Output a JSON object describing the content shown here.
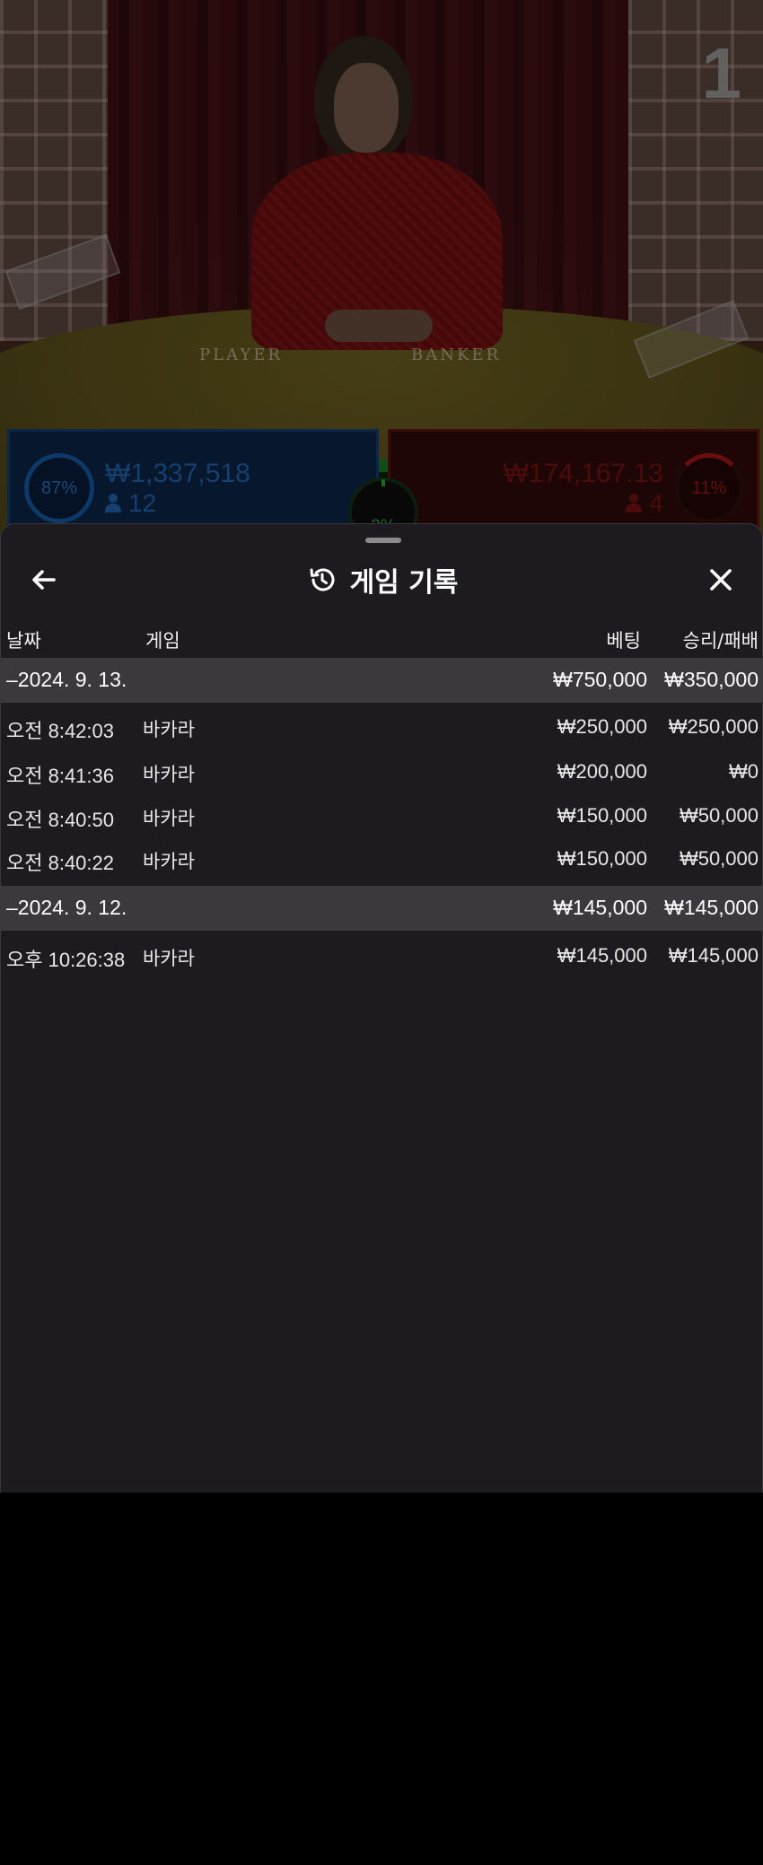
{
  "video": {
    "table_number": "1",
    "player_label": "PLAYER",
    "banker_label": "BANKER"
  },
  "bets": {
    "player": {
      "percent": "87%",
      "amount": "₩1,337,518",
      "players": "12",
      "color": "#2674c8"
    },
    "banker": {
      "percent": "11%",
      "amount": "₩174,167.13",
      "players": "4",
      "color": "#8a1414"
    },
    "tie": {
      "percent": "2%",
      "color": "#2fbf3c"
    }
  },
  "sheet": {
    "title": "게임 기록",
    "icons": {
      "back": "arrow-left-icon",
      "title": "history-icon",
      "close": "close-icon"
    },
    "columns": {
      "date": "날짜",
      "game": "게임",
      "bet": "베팅",
      "win_loss": "승리/패배"
    },
    "groups": [
      {
        "date": "–2024. 9. 13.",
        "bet": "₩750,000",
        "win_loss": "₩350,000",
        "rows": [
          {
            "time": "오전 8:42:03",
            "game": "바카라",
            "bet": "₩250,000",
            "win_loss": "₩250,000"
          },
          {
            "time": "오전 8:41:36",
            "game": "바카라",
            "bet": "₩200,000",
            "win_loss": "₩0"
          },
          {
            "time": "오전 8:40:50",
            "game": "바카라",
            "bet": "₩150,000",
            "win_loss": "₩50,000"
          },
          {
            "time": "오전 8:40:22",
            "game": "바카라",
            "bet": "₩150,000",
            "win_loss": "₩50,000"
          }
        ]
      },
      {
        "date": "–2024. 9. 12.",
        "bet": "₩145,000",
        "win_loss": "₩145,000",
        "rows": [
          {
            "time": "오후 10:26:38",
            "game": "바카라",
            "bet": "₩145,000",
            "win_loss": "₩145,000"
          }
        ]
      }
    ]
  }
}
